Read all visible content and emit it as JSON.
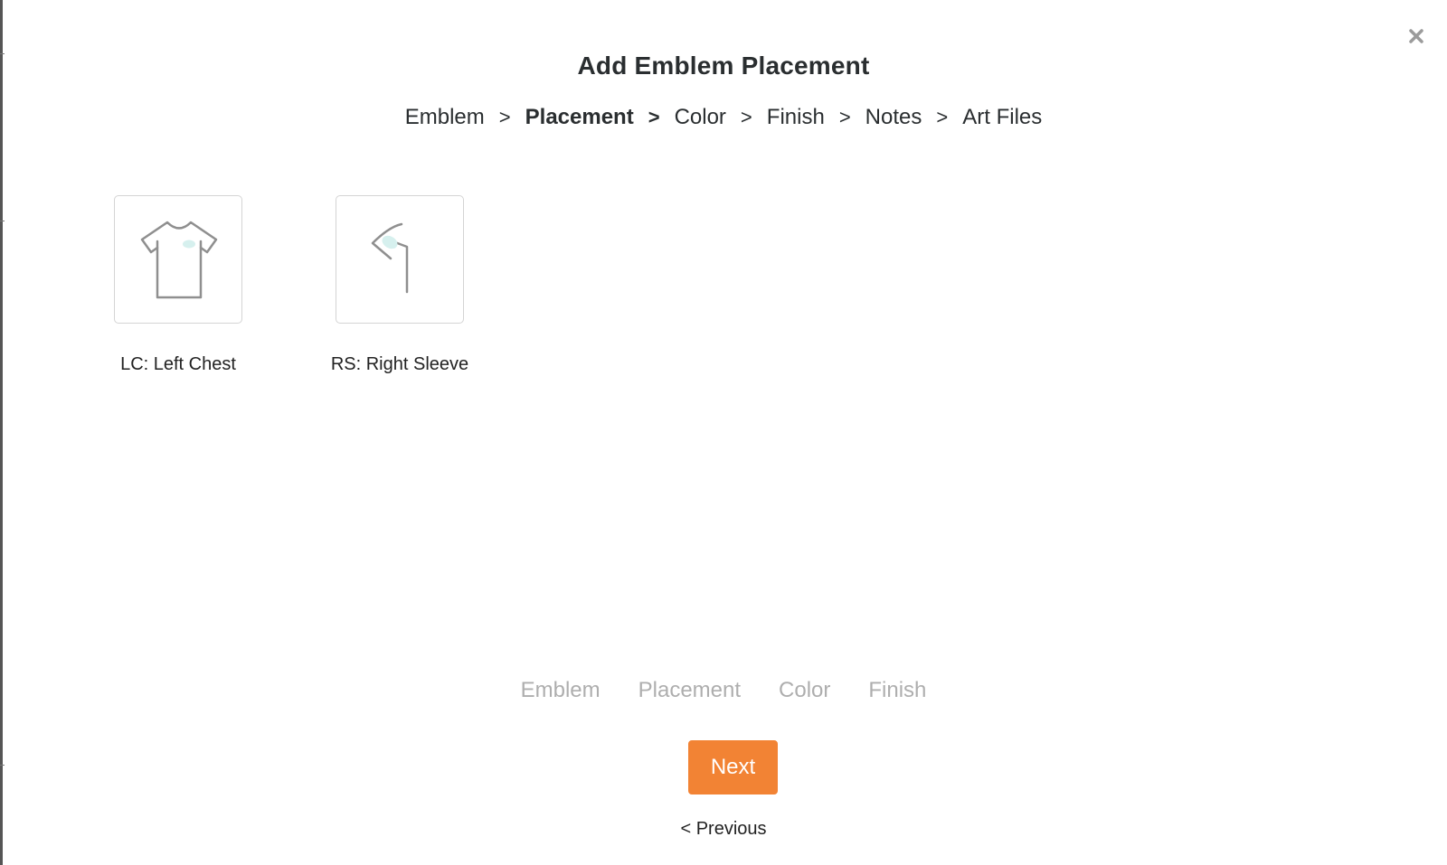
{
  "modal": {
    "title": "Add Emblem Placement",
    "close_icon": "close-icon"
  },
  "breadcrumb": {
    "items": [
      "Emblem",
      "Placement",
      "Color",
      "Finish",
      "Notes",
      "Art Files"
    ],
    "active_index": 1,
    "separator": ">"
  },
  "placements": [
    {
      "label": "LC: Left Chest",
      "icon": "tshirt-left-chest-icon"
    },
    {
      "label": "RS: Right Sleeve",
      "icon": "sleeve-icon"
    }
  ],
  "steps": {
    "items": [
      "Emblem",
      "Placement",
      "Color",
      "Finish"
    ]
  },
  "actions": {
    "next_label": "Next",
    "previous_label": "< Previous"
  },
  "colors": {
    "accent": "#f28334",
    "title_text": "#2a2e30",
    "inactive_step": "#aeaeae",
    "tile_border": "#d4d4d4",
    "emblem_highlight": "#d6f0ee"
  }
}
